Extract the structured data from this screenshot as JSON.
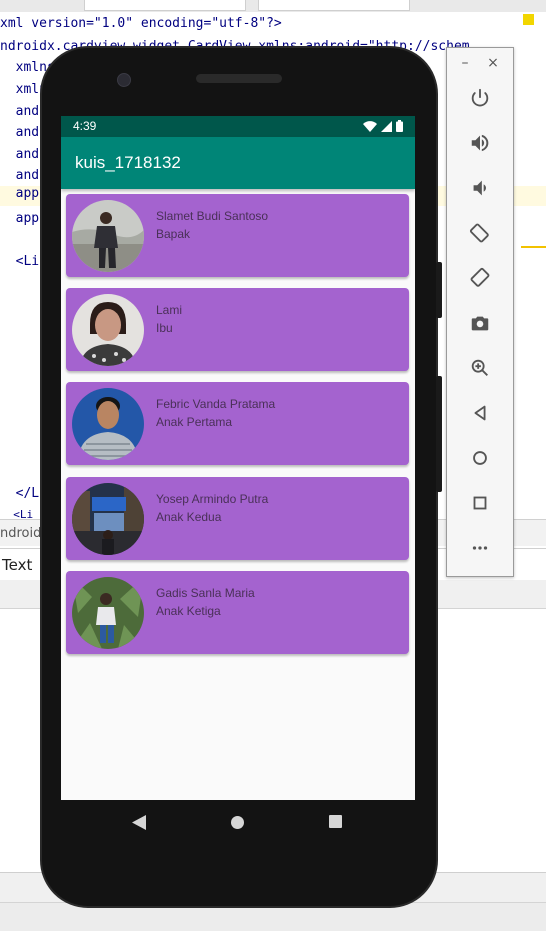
{
  "ide": {
    "code_lines": [
      {
        "a": "xml version=\"1.0\" encoding=\"utf-8\"?>"
      },
      {
        "a": "ndroidx.cardview.widget.CardView xmlns:android=\"http://schem"
      },
      {
        "a": "  xmlns"
      },
      {
        "a": "  xmln"
      },
      {
        "a": "  andr"
      },
      {
        "a": "  andr"
      },
      {
        "a": "  andr"
      },
      {
        "a": "  andr"
      },
      {
        "a": "  app"
      },
      {
        "a": "  app"
      },
      {
        "a": ""
      },
      {
        "a": "  <Li"
      }
    ],
    "closing_tag": "  </L",
    "closing_tag2": "  <Li",
    "breadcrumb": "ndroidx",
    "text_tab": "Text"
  },
  "emulator_panel": {
    "minimize": "–",
    "close": "×",
    "buttons": [
      "power",
      "volume-up",
      "volume-down",
      "rotate-left",
      "rotate-right",
      "camera",
      "zoom",
      "back",
      "home",
      "overview",
      "more"
    ]
  },
  "phone": {
    "status_time": "4:39",
    "app_title": "kuis_1718132",
    "items": [
      {
        "name": "Slamet Budi Santoso",
        "role": "Bapak"
      },
      {
        "name": "Lami",
        "role": "Ibu"
      },
      {
        "name": "Febric Vanda Pratama",
        "role": "Anak Pertama"
      },
      {
        "name": "Yosep Armindo Putra",
        "role": "Anak Kedua"
      },
      {
        "name": "Gadis Sanla Maria",
        "role": "Anak Ketiga"
      }
    ]
  },
  "colors": {
    "status_bar": "#00574b",
    "app_bar": "#008577",
    "card": "#a463cf"
  }
}
